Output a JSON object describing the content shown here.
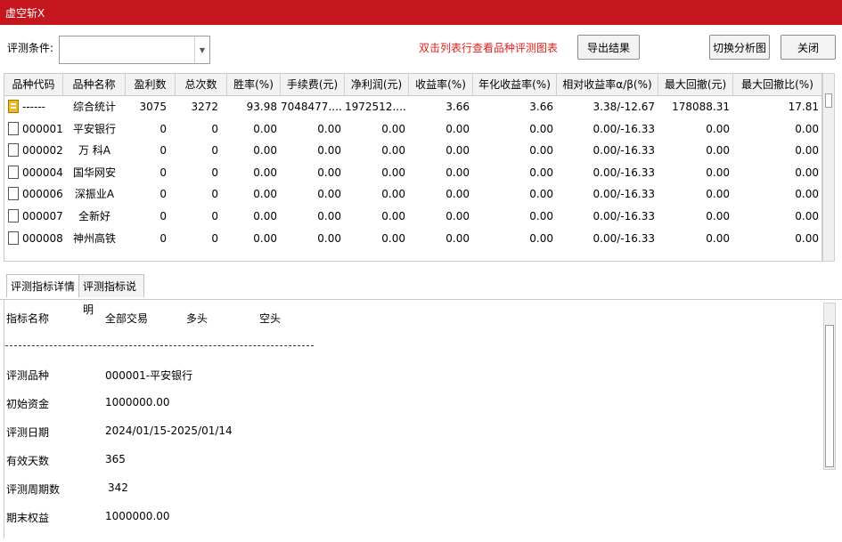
{
  "window": {
    "title": "虚空斩X"
  },
  "toolbar": {
    "condition_label": "评测条件:",
    "condition_value": "",
    "hint": "双击列表行查看品种评测图表",
    "export_label": "导出结果",
    "switch_label": "切换分析图",
    "close_label": "关闭"
  },
  "grid": {
    "headers": [
      "品种代码",
      "品种名称",
      "盈利数",
      "总次数",
      "胜率(%)",
      "手续费(元)",
      "净利润(元)",
      "收益率(%)",
      "年化收益率(%)",
      "相对收益率α/β(%)",
      "最大回撤(元)",
      "最大回撤比(%)"
    ],
    "rows": [
      [
        "------",
        "综合统计",
        "3075",
        "3272",
        "93.98",
        "7048477....",
        "1972512....",
        "3.66",
        "3.66",
        "3.38/-12.67",
        "178088.31",
        "17.81"
      ],
      [
        "000001",
        "平安银行",
        "0",
        "0",
        "0.00",
        "0.00",
        "0.00",
        "0.00",
        "0.00",
        "0.00/-16.33",
        "0.00",
        "0.00"
      ],
      [
        "000002",
        "万 科A",
        "0",
        "0",
        "0.00",
        "0.00",
        "0.00",
        "0.00",
        "0.00",
        "0.00/-16.33",
        "0.00",
        "0.00"
      ],
      [
        "000004",
        "国华网安",
        "0",
        "0",
        "0.00",
        "0.00",
        "0.00",
        "0.00",
        "0.00",
        "0.00/-16.33",
        "0.00",
        "0.00"
      ],
      [
        "000006",
        "深振业A",
        "0",
        "0",
        "0.00",
        "0.00",
        "0.00",
        "0.00",
        "0.00",
        "0.00/-16.33",
        "0.00",
        "0.00"
      ],
      [
        "000007",
        "全新好",
        "0",
        "0",
        "0.00",
        "0.00",
        "0.00",
        "0.00",
        "0.00",
        "0.00/-16.33",
        "0.00",
        "0.00"
      ],
      [
        "000008",
        "神州高铁",
        "0",
        "0",
        "0.00",
        "0.00",
        "0.00",
        "0.00",
        "0.00",
        "0.00/-16.33",
        "0.00",
        "0.00"
      ]
    ]
  },
  "tabs": [
    "评测指标详情",
    "评测指标说明"
  ],
  "detail": {
    "col_header": [
      "指标名称",
      "全部交易",
      "多头",
      "空头"
    ],
    "items": [
      {
        "label": "评测品种",
        "value": "000001-平安银行"
      },
      {
        "label": "初始资金",
        "value": "1000000.00"
      },
      {
        "label": "评测日期",
        "value": "2024/01/15-2025/01/14"
      },
      {
        "label": "有效天数",
        "value": "365"
      },
      {
        "label": "评测周期数",
        "value": "342"
      },
      {
        "label": "期末权益",
        "value": "1000000.00"
      }
    ]
  },
  "icons": {
    "summary_row": "summary-doc-icon",
    "stock_row": "doc-icon",
    "combo_arrow": "chevron-down-icon"
  },
  "colors": {
    "titlebar": "#c5161d",
    "hint": "#e0201d",
    "summary_icon": "#f1b91c"
  }
}
